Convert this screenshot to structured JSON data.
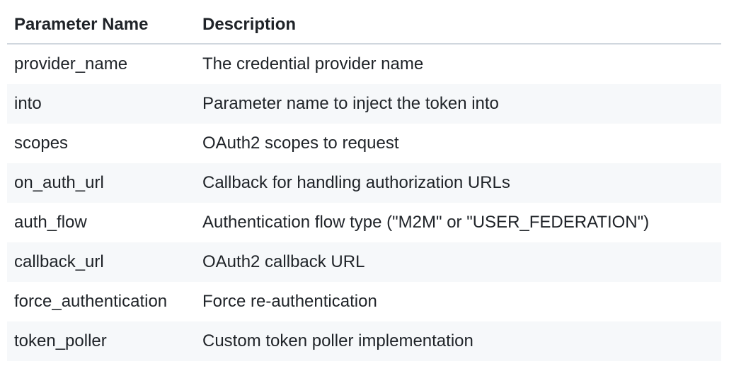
{
  "table": {
    "headers": {
      "name": "Parameter Name",
      "description": "Description"
    },
    "rows": [
      {
        "name": "provider_name",
        "description": "The credential provider name"
      },
      {
        "name": "into",
        "description": "Parameter name to inject the token into"
      },
      {
        "name": "scopes",
        "description": "OAuth2 scopes to request"
      },
      {
        "name": "on_auth_url",
        "description": "Callback for handling authorization URLs"
      },
      {
        "name": "auth_flow",
        "description": "Authentication flow type (\"M2M\" or \"USER_FEDERATION\")"
      },
      {
        "name": "callback_url",
        "description": "OAuth2 callback URL"
      },
      {
        "name": "force_authentication",
        "description": "Force re-authentication"
      },
      {
        "name": "token_poller",
        "description": "Custom token poller implementation"
      }
    ]
  }
}
